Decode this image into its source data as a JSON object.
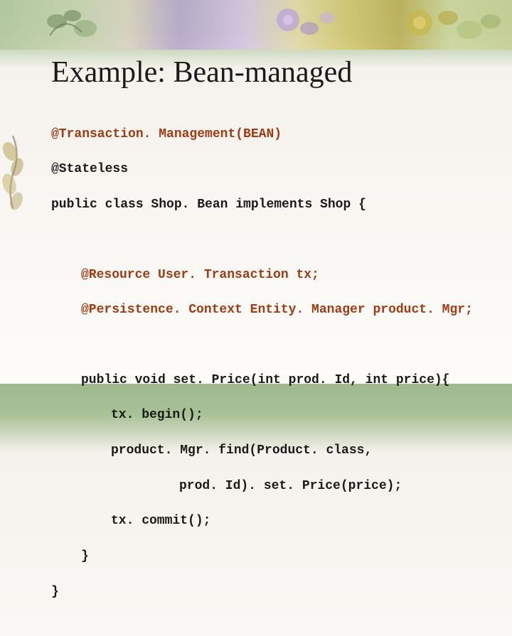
{
  "title": "Example: Bean-managed",
  "code": {
    "l1": "@Transaction. Management(BEAN)",
    "l2": "@Stateless",
    "l3": "public class Shop. Bean implements Shop {",
    "l4": "@Resource User. Transaction tx;",
    "l5": "@Persistence. Context Entity. Manager product. Mgr;",
    "l6": "public void set. Price(int prod. Id, int price){",
    "l7": "tx. begin();",
    "l8": "product. Mgr. find(Product. class,",
    "l9": "prod. Id). set. Price(price);",
    "l10": "tx. commit();",
    "l11": "}",
    "l12": "}"
  },
  "decor": {
    "banner": "floral-banner",
    "sidebar": "leaf-accent"
  }
}
